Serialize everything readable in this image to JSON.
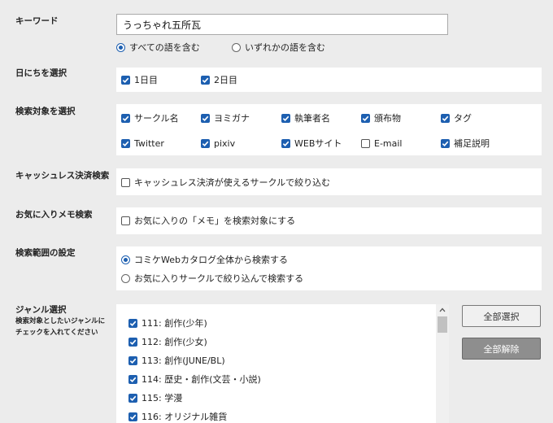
{
  "keyword": {
    "label": "キーワード",
    "value": "うっちゃれ五所瓦"
  },
  "keyword_mode": [
    {
      "label": "すべての語を含む",
      "selected": true
    },
    {
      "label": "いずれかの語を含む",
      "selected": false
    }
  ],
  "days": {
    "label": "日にちを選択",
    "items": [
      {
        "label": "1日目",
        "checked": true
      },
      {
        "label": "2日目",
        "checked": true
      }
    ]
  },
  "targets": {
    "label": "検索対象を選択",
    "items": [
      {
        "label": "サークル名",
        "checked": true
      },
      {
        "label": "ヨミガナ",
        "checked": true
      },
      {
        "label": "執筆者名",
        "checked": true
      },
      {
        "label": "頒布物",
        "checked": true
      },
      {
        "label": "タグ",
        "checked": true
      },
      {
        "label": "Twitter",
        "checked": true
      },
      {
        "label": "pixiv",
        "checked": true
      },
      {
        "label": "WEBサイト",
        "checked": true
      },
      {
        "label": "E-mail",
        "checked": false
      },
      {
        "label": "補足説明",
        "checked": true
      }
    ]
  },
  "cashless": {
    "label": "キャッシュレス決済検索",
    "option": "キャッシュレス決済が使えるサークルで絞り込む",
    "checked": false
  },
  "memo": {
    "label": "お気に入りメモ検索",
    "option": "お気に入りの「メモ」を検索対象にする",
    "checked": false
  },
  "scope": {
    "label": "検索範囲の設定",
    "options": [
      {
        "label": "コミケWebカタログ全体から検索する",
        "selected": true
      },
      {
        "label": "お気に入りサークルで絞り込んで検索する",
        "selected": false
      }
    ]
  },
  "genre": {
    "label": "ジャンル選択",
    "hint_line1": "検索対象としたいジャンルに",
    "hint_line2": "チェックを入れてください",
    "items": [
      {
        "label": "111: 創作(少年)",
        "checked": true
      },
      {
        "label": "112: 創作(少女)",
        "checked": true
      },
      {
        "label": "113: 創作(JUNE/BL)",
        "checked": true
      },
      {
        "label": "114: 歴史・創作(文芸・小説)",
        "checked": true
      },
      {
        "label": "115: 学漫",
        "checked": true
      },
      {
        "label": "116: オリジナル雑貨",
        "checked": true
      }
    ],
    "select_all": "全部選択",
    "clear_all": "全部解除"
  },
  "colors": {
    "accent": "#1d5fb0",
    "background": "#ececec"
  },
  "icons": {
    "checkbox": "checkmark-icon",
    "scroll": "chevron-up-icon"
  }
}
